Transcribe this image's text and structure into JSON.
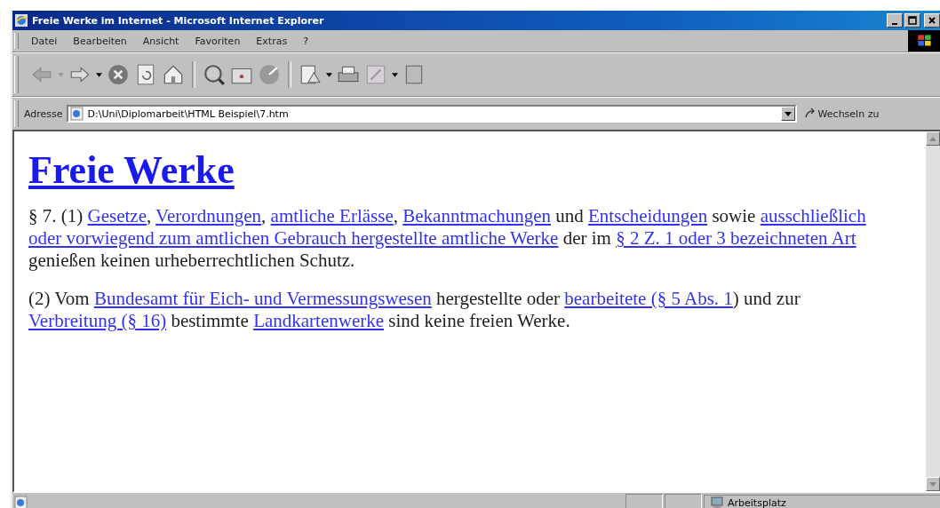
{
  "window": {
    "title": "Freie Werke im Internet - Microsoft Internet Explorer"
  },
  "menu": [
    "Datei",
    "Bearbeiten",
    "Ansicht",
    "Favoriten",
    "Extras",
    "?"
  ],
  "address": {
    "label": "Adresse",
    "value": "D:\\Uni\\Diplomarbeit\\HTML Beispiel\\7.htm",
    "go": "Wechseln zu"
  },
  "page": {
    "heading": "Freie Werke",
    "paragraphs": [
      [
        {
          "kind": "text",
          "text": "§ 7. (1) "
        },
        {
          "kind": "link",
          "text": "Gesetze"
        },
        {
          "kind": "text",
          "text": ", "
        },
        {
          "kind": "link",
          "text": "Verordnungen"
        },
        {
          "kind": "text",
          "text": ", "
        },
        {
          "kind": "link",
          "text": "amtliche Erlässe"
        },
        {
          "kind": "text",
          "text": ", "
        },
        {
          "kind": "link",
          "text": "Bekanntmachungen"
        },
        {
          "kind": "text",
          "text": " und "
        },
        {
          "kind": "link",
          "text": "Entscheidungen"
        },
        {
          "kind": "text",
          "text": " sowie "
        },
        {
          "kind": "link",
          "text": "ausschließlich"
        },
        {
          "kind": "link",
          "text": "oder vorwiegend zum amtlichen Gebrauch hergestellte amtliche Werke"
        },
        {
          "kind": "text",
          "text": " der im "
        },
        {
          "kind": "link",
          "text": "§ 2 Z. 1 oder 3 bezeichneten Art"
        },
        {
          "kind": "text",
          "text": " genießen keinen urheberrechtlichen Schutz."
        }
      ],
      [
        {
          "kind": "text",
          "text": "(2) Vom "
        },
        {
          "kind": "link",
          "text": "Bundesamt für Eich- und Vermessungswesen"
        },
        {
          "kind": "text",
          "text": " hergestellte oder "
        },
        {
          "kind": "link",
          "text": "bearbeitete (§ 5 Abs. 1"
        },
        {
          "kind": "text",
          "text": ") und zur "
        },
        {
          "kind": "link",
          "text": "Verbreitung (§ 16)"
        },
        {
          "kind": "text",
          "text": " bestimmte "
        },
        {
          "kind": "link",
          "text": "Landkartenwerke"
        },
        {
          "kind": "text",
          "text": " sind keine freien Werke."
        }
      ]
    ]
  },
  "status_bar": {
    "zone": "Arbeitsplatz"
  }
}
